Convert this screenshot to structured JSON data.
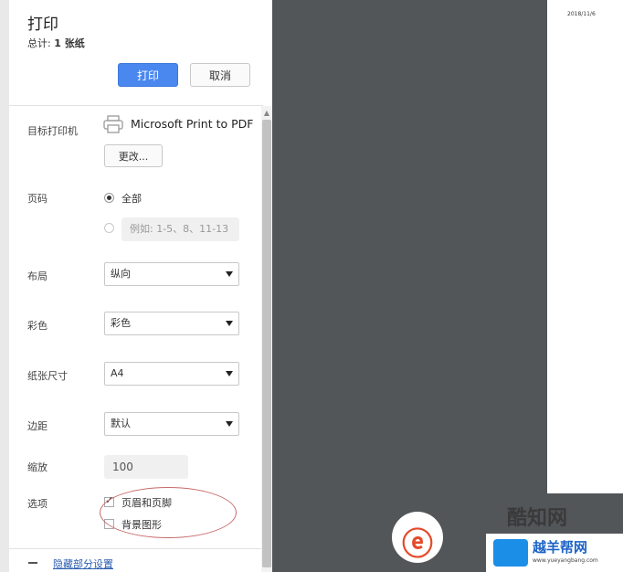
{
  "header": {
    "title": "打印",
    "total_prefix": "总计:",
    "total_value": "1 张纸"
  },
  "buttons": {
    "print": "打印",
    "cancel": "取消"
  },
  "destination": {
    "label": "目标打印机",
    "printer": "Microsoft Print to PDF",
    "change": "更改..."
  },
  "pages": {
    "label": "页码",
    "all": "全部",
    "custom_placeholder": "例如: 1-5、8、11-13"
  },
  "layout": {
    "label": "布局",
    "value": "纵向"
  },
  "color": {
    "label": "彩色",
    "value": "彩色"
  },
  "paper": {
    "label": "纸张尺寸",
    "value": "A4"
  },
  "margins": {
    "label": "边距",
    "value": "默认"
  },
  "scale": {
    "label": "缩放",
    "value": "100"
  },
  "options": {
    "label": "选项",
    "headers_footers": "页眉和页脚",
    "background": "背景图形"
  },
  "footer": {
    "hide_settings": "隐藏部分设置"
  },
  "preview": {
    "date": "2018/11/6"
  },
  "watermark": {
    "brand": "酷知网",
    "site": "越羊帮网",
    "url": "www.yueyangbang.com"
  }
}
